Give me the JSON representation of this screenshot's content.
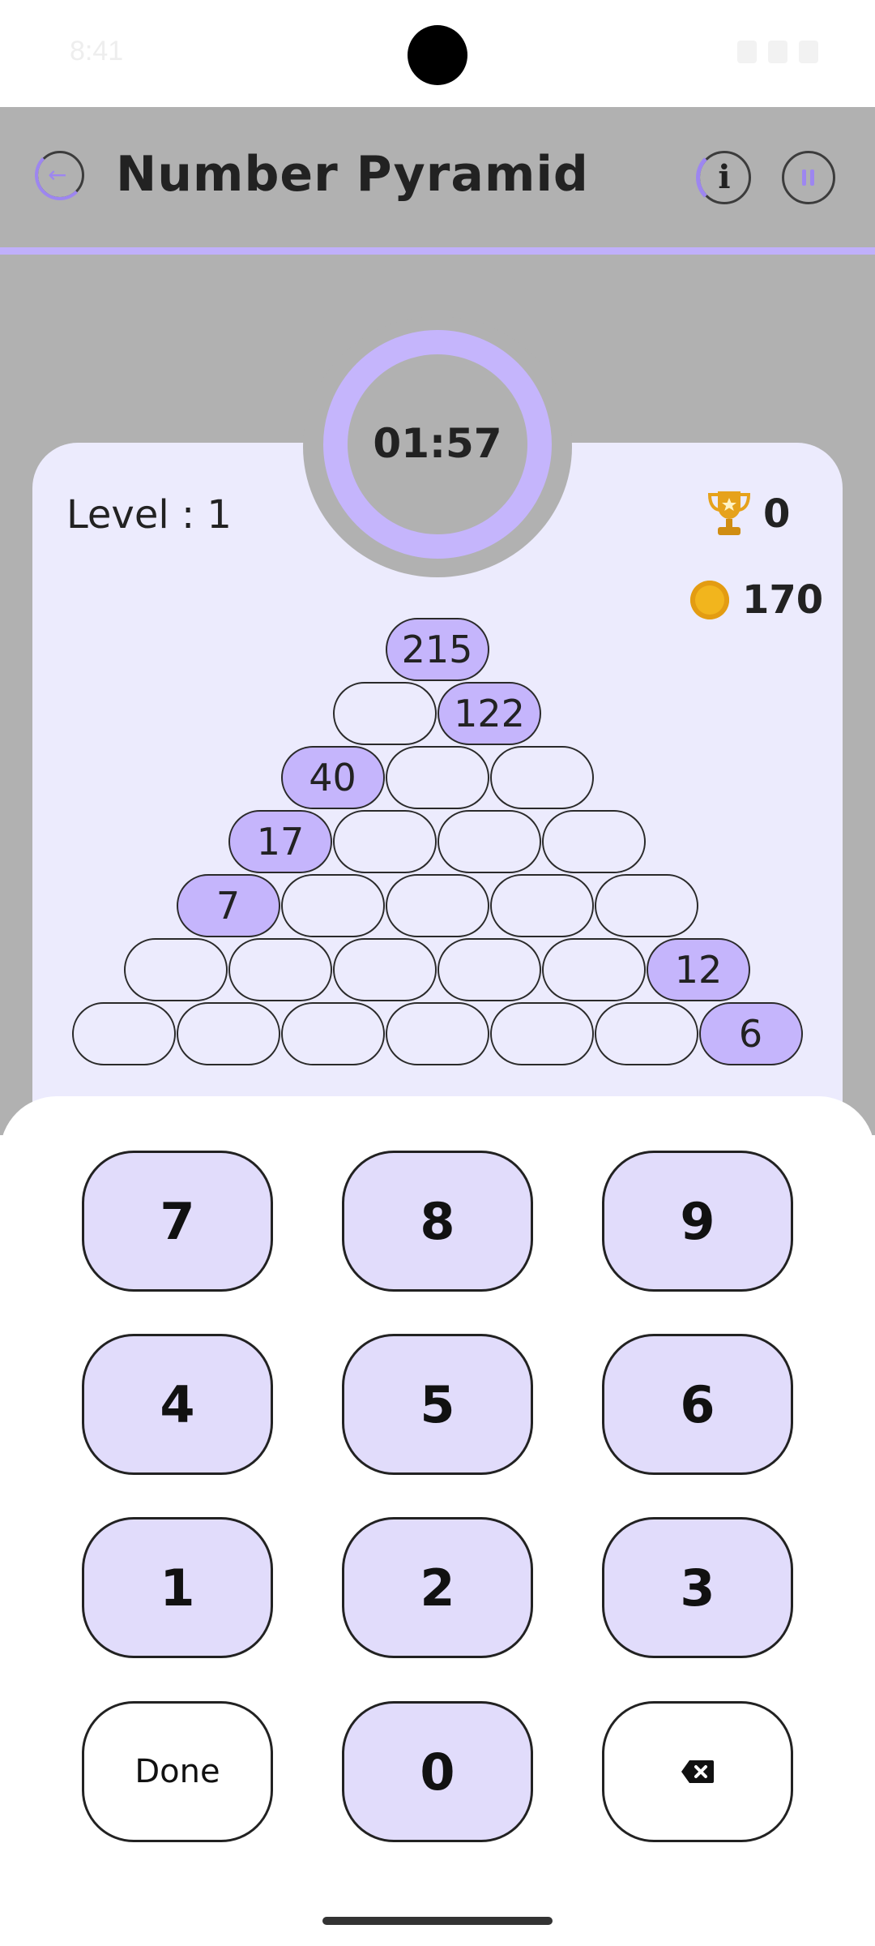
{
  "status_bar": {
    "time": "8:41"
  },
  "header": {
    "title": "Number Pyramid",
    "back_icon": "back-arrow-icon",
    "info_icon": "info-icon",
    "pause_icon": "pause-icon"
  },
  "timer": {
    "display": "01:57"
  },
  "stats": {
    "level": "Level : 1",
    "trophies": "0",
    "coins": "170"
  },
  "pyramid": {
    "rows": [
      [
        "215"
      ],
      [
        "",
        "122"
      ],
      [
        "40",
        "",
        ""
      ],
      [
        "17",
        "",
        "",
        ""
      ],
      [
        "7",
        "",
        "",
        "",
        ""
      ],
      [
        "",
        "",
        "",
        "",
        "",
        "12"
      ],
      [
        "",
        "",
        "",
        "",
        "",
        "",
        "6"
      ]
    ]
  },
  "keypad": {
    "keys": [
      [
        "7",
        "8",
        "9"
      ],
      [
        "4",
        "5",
        "6"
      ],
      [
        "1",
        "2",
        "3"
      ],
      [
        "Done",
        "0",
        "backspace"
      ]
    ]
  },
  "colors": {
    "accent": "#9d86f0",
    "given_cell": "#c5b5fc",
    "card_bg": "#ecebfd",
    "key_bg": "#e1dcfb",
    "dim_bg": "#b1b1b1",
    "coin": "#f2b51d",
    "trophy": "#e6a21b"
  }
}
